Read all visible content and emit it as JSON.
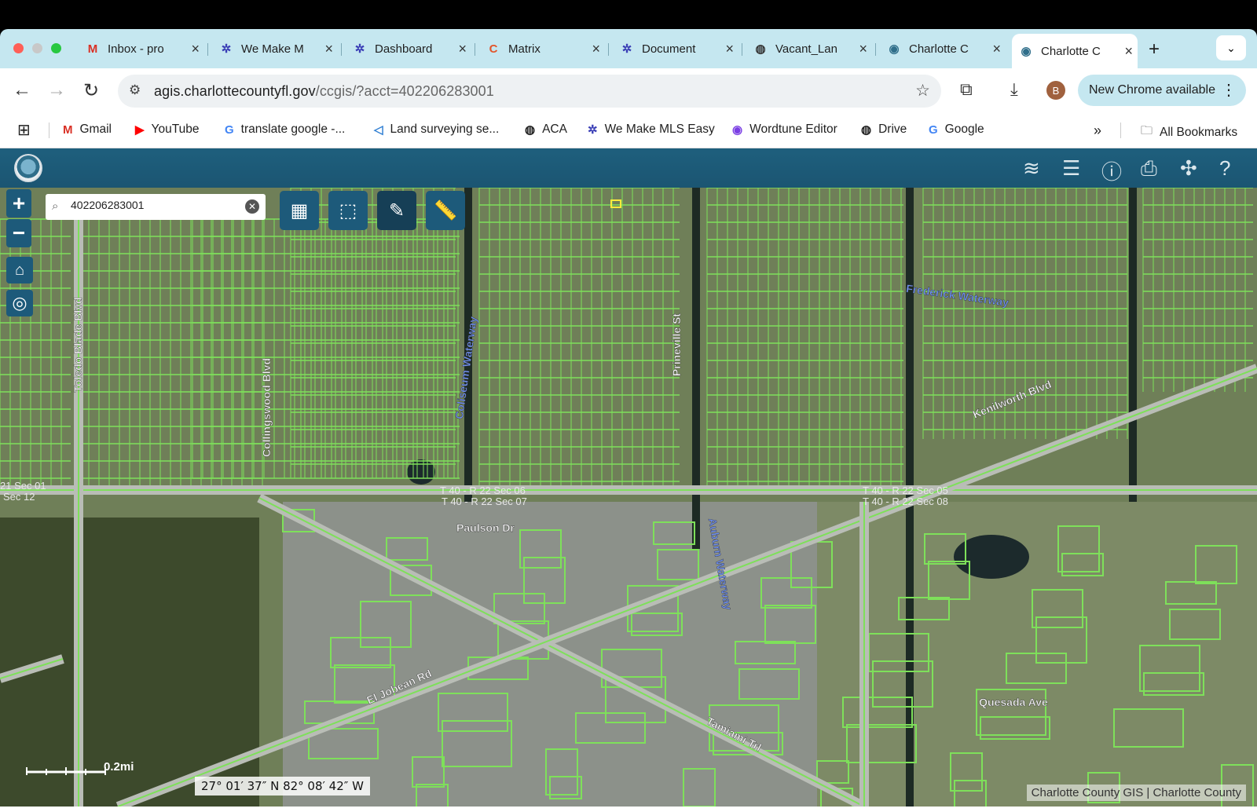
{
  "tabs": [
    {
      "title": "Inbox - pro",
      "favicon": "gmail-icon",
      "glyph": "M",
      "color": "#d93025"
    },
    {
      "title": "We Make M",
      "favicon": "mls-icon",
      "glyph": "✲",
      "color": "#3b3fb6"
    },
    {
      "title": "Dashboard",
      "favicon": "mls-icon",
      "glyph": "✲",
      "color": "#3b3fb6"
    },
    {
      "title": "Matrix",
      "favicon": "matrix-icon",
      "glyph": "C",
      "color": "#e2552b"
    },
    {
      "title": "Document",
      "favicon": "mls-icon",
      "glyph": "✲",
      "color": "#3b3fb6"
    },
    {
      "title": "Vacant_Lan",
      "favicon": "globe-icon",
      "glyph": "◍",
      "color": "#333"
    },
    {
      "title": "Charlotte C",
      "favicon": "charlotte-county-icon",
      "glyph": "◉",
      "color": "#2f6e8a"
    },
    {
      "title": "Charlotte C",
      "favicon": "charlotte-county-icon",
      "glyph": "◉",
      "color": "#2f6e8a",
      "active": true
    }
  ],
  "omnibox": {
    "domain": "agis.charlottecountyfl.gov",
    "path": "/ccgis/?acct=402206283001"
  },
  "chrome_update": "New Chrome available",
  "avatar_letter": "B",
  "bookmarks": [
    {
      "label": "Gmail",
      "icon": "gmail-icon",
      "glyph": "M",
      "color": "#d93025"
    },
    {
      "label": "YouTube",
      "icon": "youtube-icon",
      "glyph": "▶",
      "color": "#ff0000"
    },
    {
      "label": "translate google -...",
      "icon": "google-icon",
      "glyph": "G",
      "color": "#4285f4"
    },
    {
      "label": "Land surveying se...",
      "icon": "survey-icon",
      "glyph": "◁",
      "color": "#2d7dd2"
    },
    {
      "label": "ACA",
      "icon": "globe-icon",
      "glyph": "◍",
      "color": "#222"
    },
    {
      "label": "We Make MLS Easy",
      "icon": "mls-icon",
      "glyph": "✲",
      "color": "#3b3fb6"
    },
    {
      "label": "Wordtune Editor",
      "icon": "wordtune-icon",
      "glyph": "◉",
      "color": "#7b3fe4"
    },
    {
      "label": "Drive",
      "icon": "globe-icon",
      "glyph": "◍",
      "color": "#222"
    },
    {
      "label": "Google",
      "icon": "google-icon",
      "glyph": "G",
      "color": "#4285f4"
    }
  ],
  "all_bookmarks": "All Bookmarks",
  "search": {
    "value": "402206283001"
  },
  "map": {
    "road_labels": [
      {
        "text": "Toledo Blade Blvd"
      },
      {
        "text": "Collingswood Blvd"
      },
      {
        "text": "Coliseum Waterway"
      },
      {
        "text": "Prineville St"
      },
      {
        "text": "Frederick Waterway"
      },
      {
        "text": "Kenilworth Blvd"
      },
      {
        "text": "Paulson Dr"
      },
      {
        "text": "El Jobean Rd"
      },
      {
        "text": "Tamiami Trl"
      },
      {
        "text": "Quesada Ave"
      },
      {
        "text": "Auburn Waterway"
      }
    ],
    "section_labels": [
      {
        "text": "T 40 - R 22 Sec 06"
      },
      {
        "text": "T 40 - R 22 Sec 07"
      },
      {
        "text": "T 40 - R 22 Sec 05"
      },
      {
        "text": "T 40 - R 22 Sec 08"
      },
      {
        "text": "21 Sec 01"
      },
      {
        "text": "Sec 12"
      }
    ],
    "scale_label": "0.2mi",
    "coordinates": "27° 01′ 37″ N 82° 08′ 42″ W",
    "attribution": "Charlotte County GIS | Charlotte County"
  },
  "colors": {
    "appbar": "#1d5a7a",
    "parcel": "#7ee05a",
    "tabstrip": "#c5e7f0"
  }
}
